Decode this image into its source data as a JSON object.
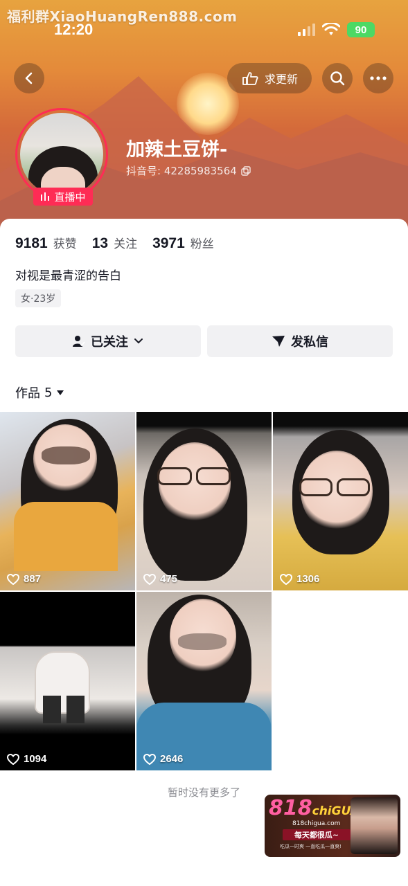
{
  "watermark": "福利群XiaoHuangRen888.com",
  "status_bar": {
    "time": "12:20",
    "battery": "90"
  },
  "header": {
    "update_button": "求更新",
    "colors": {
      "live": "#fe2c55",
      "hero_top": "#e7a33f",
      "hero_bottom": "#b9664c"
    }
  },
  "profile": {
    "name": "加辣土豆饼-",
    "douyin_id": "抖音号: 42285983564",
    "live_badge": "直播中",
    "stats": [
      {
        "num": "9181",
        "label": "获赞"
      },
      {
        "num": "13",
        "label": "关注"
      },
      {
        "num": "3971",
        "label": "粉丝"
      }
    ],
    "bio": "对视是最青涩的告白",
    "tag": "女·23岁"
  },
  "actions": {
    "follow": "已关注",
    "message": "发私信"
  },
  "works": {
    "label": "作品",
    "count": "5",
    "items": [
      {
        "likes": "887"
      },
      {
        "likes": "475"
      },
      {
        "likes": "1306"
      },
      {
        "likes": "1094"
      },
      {
        "likes": "2646"
      }
    ],
    "footer": "暂时没有更多了"
  },
  "ad": {
    "logo_num": "818",
    "logo_text": "chiGUA",
    "site": "818chigua.com",
    "slogan": "每天都很瓜~",
    "sub": "吃瓜一时爽 一直吃瓜一直爽!"
  }
}
